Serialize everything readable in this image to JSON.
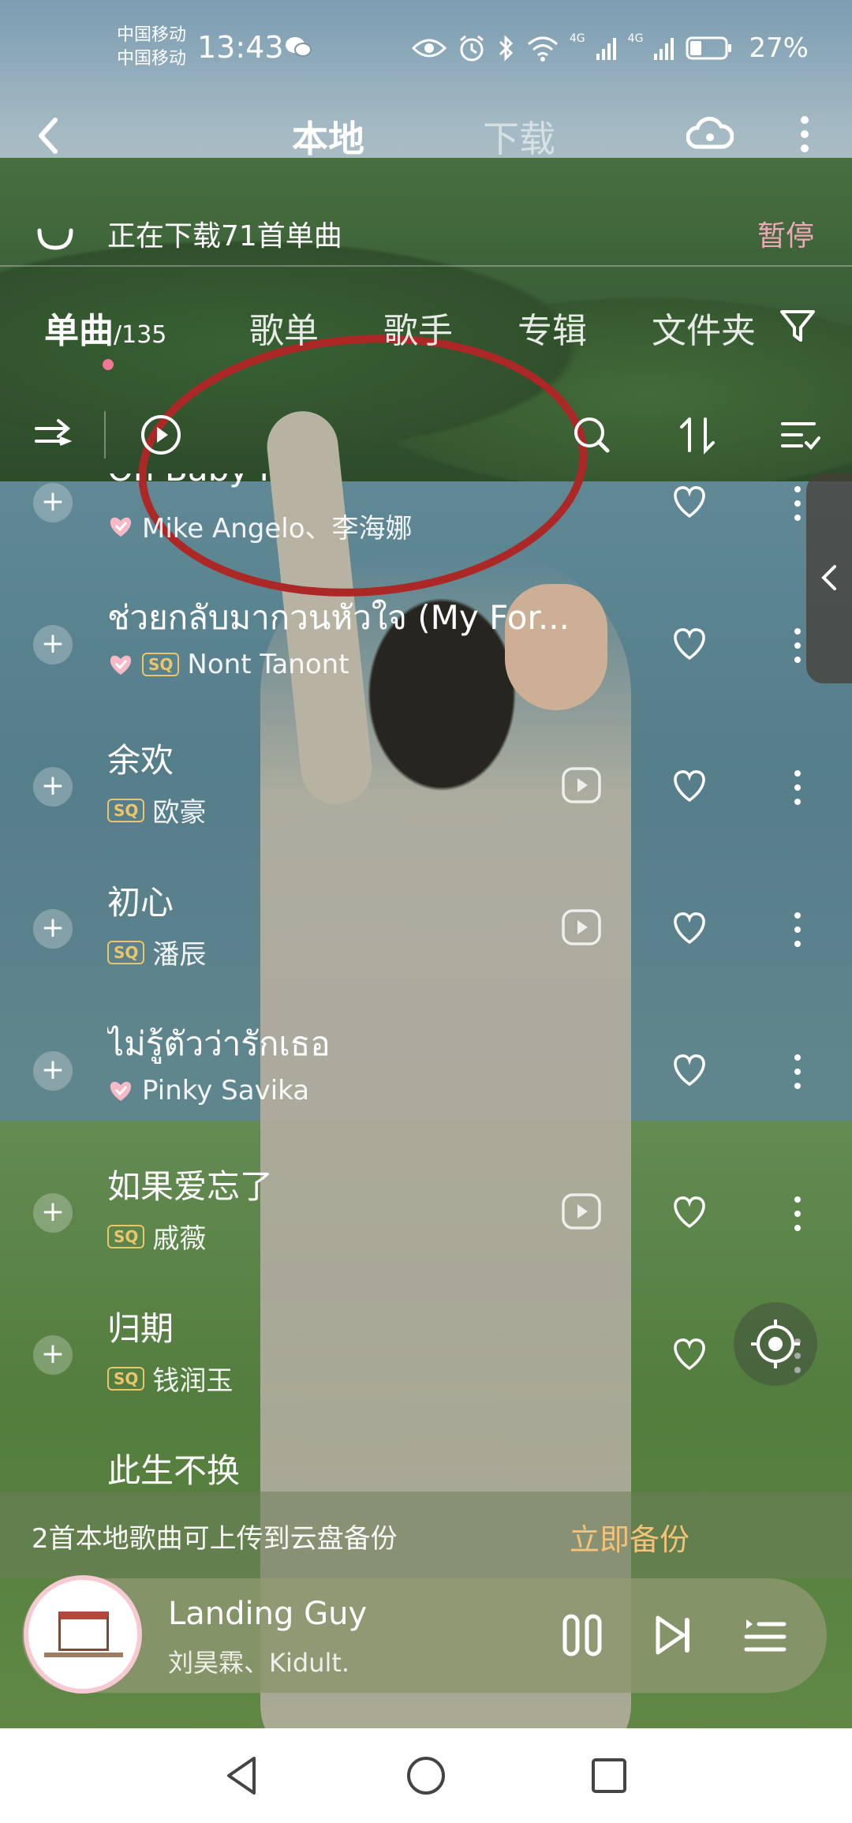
{
  "status_bar": {
    "carrier1": "中国移动",
    "carrier2": "中国移动",
    "time": "13:43",
    "network1": "4G",
    "network2": "4G",
    "battery": "27%"
  },
  "header": {
    "tab_local": "本地",
    "tab_download": "下载"
  },
  "download_banner": {
    "text": "正在下载71首单曲",
    "action": "暂停"
  },
  "category_tabs": {
    "singles": "单曲",
    "singles_count": "/135",
    "playlists": "歌单",
    "artists": "歌手",
    "albums": "专辑",
    "folders": "文件夹"
  },
  "songs": [
    {
      "title": "Oh Baby I",
      "artist": "Mike Angelo、李海娜",
      "badge_vip": true,
      "badge_sq": false,
      "has_mv": false
    },
    {
      "title": "ช่วยกลับมากวนหัวใจ (My For...",
      "artist": "Nont Tanont",
      "badge_vip": true,
      "badge_sq": true,
      "has_mv": false
    },
    {
      "title": "余欢",
      "artist": "欧豪",
      "badge_vip": false,
      "badge_sq": true,
      "has_mv": true
    },
    {
      "title": "初心",
      "artist": "潘辰",
      "badge_vip": false,
      "badge_sq": true,
      "has_mv": true
    },
    {
      "title": "ไม่รู้ตัวว่ารักเธอ",
      "artist": "Pinky Savika",
      "badge_vip": true,
      "badge_sq": false,
      "has_mv": false
    },
    {
      "title": "如果爱忘了",
      "artist": "戚薇",
      "badge_vip": false,
      "badge_sq": true,
      "has_mv": true
    },
    {
      "title": "归期",
      "artist": "钱润玉",
      "badge_vip": false,
      "badge_sq": true,
      "has_mv": false
    },
    {
      "title": "此生不换",
      "artist": "",
      "badge_vip": false,
      "badge_sq": false,
      "has_mv": false
    }
  ],
  "badges": {
    "sq": "SQ"
  },
  "backup_banner": {
    "text": "2首本地歌曲可上传到云盘备份",
    "action": "立即备份"
  },
  "player": {
    "title": "Landing Guy",
    "artist": "刘昊霖、Kidult."
  },
  "colors": {
    "accent": "#f07896",
    "sq_gold": "#e9c56b",
    "backup_orange": "#f2c278"
  }
}
